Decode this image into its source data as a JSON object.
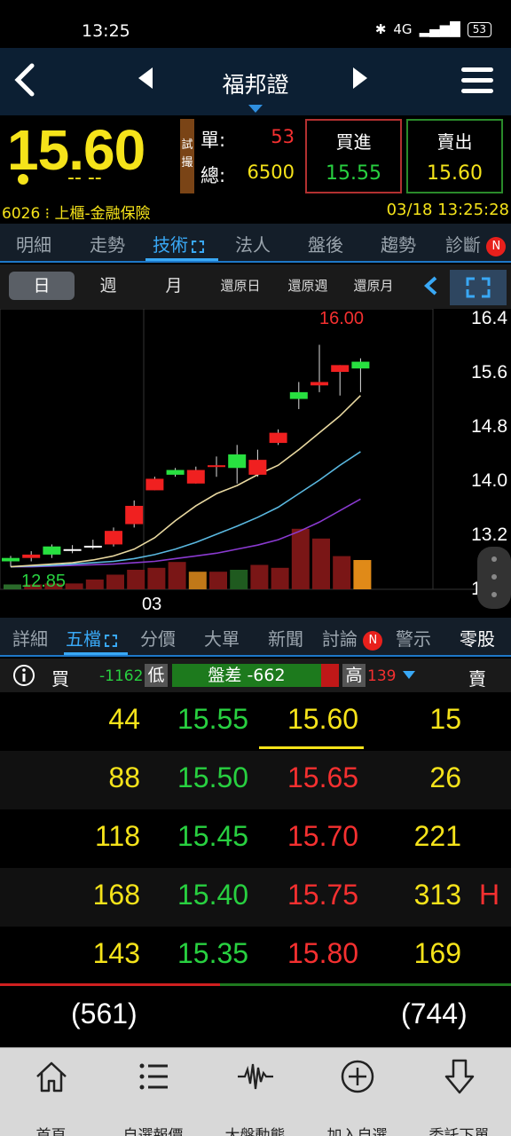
{
  "status_bar": {
    "time": "13:25",
    "network": "4G",
    "battery": "53"
  },
  "nav": {
    "title": "福邦證"
  },
  "quote": {
    "price": "15.60",
    "change": "-- --",
    "trial_label": "試撮",
    "single_label": "單:",
    "single_value": "53",
    "total_label": "總:",
    "total_value": "6500",
    "buy_label": "買進",
    "buy_price": "15.55",
    "sell_label": "賣出",
    "sell_price": "15.60",
    "code_market": "6026 ⁝ 上櫃-金融保險",
    "datetime": "03/18 13:25:28"
  },
  "tabs_top": [
    "明細",
    "走勢",
    "技術",
    "法人",
    "盤後",
    "趨勢",
    "診斷"
  ],
  "badge_n": "N",
  "periods": [
    "日",
    "週",
    "月",
    "還原日",
    "還原週",
    "還原月"
  ],
  "chart_data": {
    "type": "candlestick",
    "y_ticks": [
      "16.4",
      "15.6",
      "14.8",
      "14.0",
      "13.2",
      "12.4"
    ],
    "ylim": [
      12.4,
      16.4
    ],
    "x_label": "03",
    "annotations": {
      "high": "16.00",
      "low": "12.85"
    },
    "candles": [
      {
        "o": 12.8,
        "c": 12.85,
        "h": 12.88,
        "l": 12.72,
        "dir": "up"
      },
      {
        "o": 12.9,
        "c": 12.85,
        "h": 12.95,
        "l": 12.8,
        "dir": "down"
      },
      {
        "o": 12.9,
        "c": 13.02,
        "h": 13.05,
        "l": 12.85,
        "dir": "up"
      },
      {
        "o": 12.98,
        "c": 12.98,
        "h": 13.04,
        "l": 12.92,
        "dir": "flat"
      },
      {
        "o": 13.02,
        "c": 13.03,
        "h": 13.12,
        "l": 12.98,
        "dir": "flat"
      },
      {
        "o": 13.05,
        "c": 13.25,
        "h": 13.3,
        "l": 13.02,
        "dir": "down"
      },
      {
        "o": 13.35,
        "c": 13.62,
        "h": 13.7,
        "l": 13.3,
        "dir": "down"
      },
      {
        "o": 13.85,
        "c": 14.02,
        "h": 14.05,
        "l": 13.85,
        "dir": "down"
      },
      {
        "o": 14.08,
        "c": 14.15,
        "h": 14.18,
        "l": 14.05,
        "dir": "up"
      },
      {
        "o": 14.15,
        "c": 13.95,
        "h": 14.2,
        "l": 13.95,
        "dir": "down"
      },
      {
        "o": 14.2,
        "c": 14.22,
        "h": 14.35,
        "l": 14.05,
        "dir": "down"
      },
      {
        "o": 14.18,
        "c": 14.38,
        "h": 14.52,
        "l": 13.95,
        "dir": "up"
      },
      {
        "o": 14.08,
        "c": 14.3,
        "h": 14.45,
        "l": 14.05,
        "dir": "down"
      },
      {
        "o": 14.55,
        "c": 14.7,
        "h": 14.75,
        "l": 14.52,
        "dir": "down"
      },
      {
        "o": 15.2,
        "c": 15.3,
        "h": 15.45,
        "l": 15.05,
        "dir": "up"
      },
      {
        "o": 15.4,
        "c": 15.45,
        "h": 16.0,
        "l": 15.3,
        "dir": "down"
      },
      {
        "o": 15.6,
        "c": 15.7,
        "h": 15.7,
        "l": 15.25,
        "dir": "down"
      },
      {
        "o": 15.65,
        "c": 15.75,
        "h": 15.8,
        "l": 15.3,
        "dir": "up"
      }
    ],
    "ma_short": [
      12.72,
      12.74,
      12.76,
      12.78,
      12.82,
      12.88,
      12.98,
      13.15,
      13.4,
      13.62,
      13.8,
      13.92,
      14.08,
      14.22,
      14.45,
      14.7,
      14.95,
      15.25
    ],
    "ma_mid": [
      12.72,
      12.73,
      12.74,
      12.76,
      12.78,
      12.8,
      12.84,
      12.9,
      12.98,
      13.08,
      13.2,
      13.32,
      13.45,
      13.6,
      13.8,
      14.0,
      14.22,
      14.42
    ],
    "ma_long": [
      12.72,
      12.72,
      12.73,
      12.74,
      12.75,
      12.76,
      12.78,
      12.8,
      12.84,
      12.88,
      12.92,
      12.98,
      13.04,
      13.12,
      13.24,
      13.38,
      13.55,
      13.72
    ],
    "volumes": [
      0.05,
      0.05,
      0.06,
      0.06,
      0.1,
      0.15,
      0.2,
      0.22,
      0.28,
      0.18,
      0.18,
      0.2,
      0.25,
      0.22,
      0.62,
      0.52,
      0.34,
      0.3
    ],
    "volume_colors": [
      "#2a6a2a",
      "#7a1616",
      "#7a1616",
      "#7a1616",
      "#7a1616",
      "#7a1616",
      "#7a1616",
      "#7a1616",
      "#7a1616",
      "#c07818",
      "#7a1616",
      "#1f5a1f",
      "#7a1616",
      "#7a1616",
      "#7a1616",
      "#7a1616",
      "#7a1616",
      "#e08a18"
    ]
  },
  "tabs_bottom": [
    "詳細",
    "五檔",
    "分價",
    "大單",
    "新聞",
    "討論",
    "警示",
    "零股"
  ],
  "spread": {
    "buy_label": "買",
    "left_value": "-1162",
    "low_label": "低",
    "mid_label": "盤差 -662",
    "high_label": "高",
    "right_value": "139",
    "sell_label": "賣"
  },
  "order_book": {
    "bids": [
      {
        "qty": "44",
        "price": "15.55"
      },
      {
        "qty": "88",
        "price": "15.50"
      },
      {
        "qty": "118",
        "price": "15.45"
      },
      {
        "qty": "168",
        "price": "15.40"
      },
      {
        "qty": "143",
        "price": "15.35"
      }
    ],
    "asks": [
      {
        "price": "15.60",
        "qty": "15",
        "flag": ""
      },
      {
        "price": "15.65",
        "qty": "26",
        "flag": ""
      },
      {
        "price": "15.70",
        "qty": "221",
        "flag": ""
      },
      {
        "price": "15.75",
        "qty": "313",
        "flag": "H"
      },
      {
        "price": "15.80",
        "qty": "169",
        "flag": ""
      }
    ],
    "bid_total": "(561)",
    "ask_total": "(744)",
    "bid_ratio": 0.43
  },
  "bottom_nav": [
    "首頁",
    "自選報價",
    "大盤動態",
    "加入自選",
    "委託下單"
  ],
  "colors": {
    "up": "#f43030",
    "down": "#28d040",
    "price": "#f5e31a",
    "accent": "#39a8f5"
  }
}
